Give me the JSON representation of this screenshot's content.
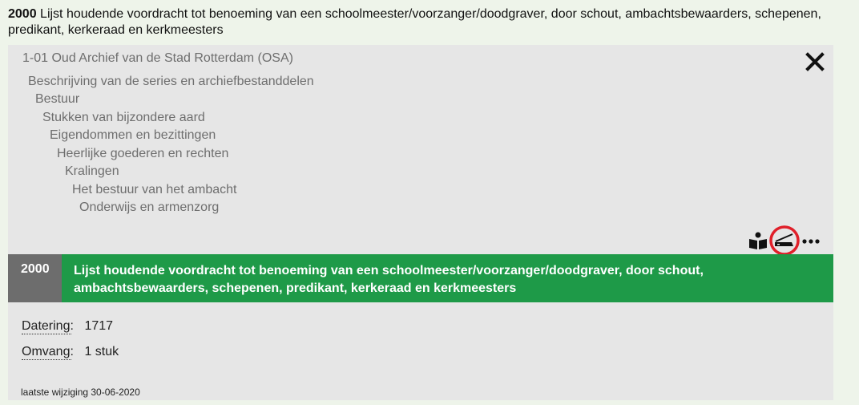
{
  "record": {
    "code": "2000",
    "title": "Lijst houdende voordracht tot benoeming van een schoolmeester/voorzanger/doodgraver, door schout, ambachtsbewaarders, schepenen, predikant, kerkeraad en kerkmeesters"
  },
  "band": {
    "code": "2000",
    "title": "Lijst houdende voordracht tot benoeming van een schoolmeester/voorzanger/doodgraver, door schout, ambachtsbewaarders, schepenen, predikant, kerkeraad en kerkmeesters"
  },
  "archive": {
    "title": "1-01 Oud Archief van de Stad Rotterdam (OSA)"
  },
  "tree": [
    "Beschrijving van de series en archiefbestanddelen",
    "Bestuur",
    "Stukken van bijzondere aard",
    "Eigendommen en bezittingen",
    "Heerlijke goederen en rechten",
    "Kralingen",
    "Het bestuur van het ambacht",
    "Onderwijs en armenzorg"
  ],
  "details": {
    "datering_label": "Datering:",
    "datering_value": "1717",
    "omvang_label": "Omvang:",
    "omvang_value": "1 stuk"
  },
  "footer": {
    "modified": "laatste wijziging 30-06-2020"
  },
  "icons": {
    "close": "close-icon",
    "reading": "reading-room-icon",
    "scan": "no-scan-icon",
    "more": "more-icon"
  },
  "colors": {
    "accent_green": "#1e9a48",
    "code_gray": "#6d6d6d",
    "alert_red": "#e0202a"
  }
}
